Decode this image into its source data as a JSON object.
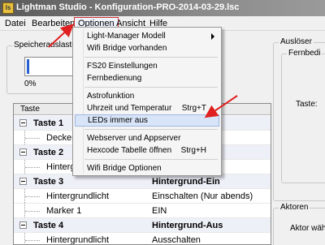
{
  "window": {
    "title": "Lightman Studio - Konfiguration-PRO-2014-03-29.lsc",
    "icon_text": "ls"
  },
  "menubar": [
    {
      "label": "Datei"
    },
    {
      "label": "Bearbeiten"
    },
    {
      "label": "Optionen",
      "active": true
    },
    {
      "label": "Ansicht"
    },
    {
      "label": "Hilfe"
    }
  ],
  "left": {
    "group_label": "Speicherauslastu",
    "progress_text": "0%",
    "progress_value": 0.05
  },
  "right": {
    "ausloeser_label": "Auslöser",
    "fernbedienung_label": "Fernbedi",
    "taste_label": "Taste:",
    "aktoren_label": "Aktoren",
    "aktor_waehlen_label": "Aktor wähl"
  },
  "tree": {
    "column_header": "Taste",
    "rows": [
      {
        "kind": "group",
        "c1": "Taste 1",
        "c2": ""
      },
      {
        "kind": "child",
        "c1": "Deckenl",
        "c2": ""
      },
      {
        "kind": "group",
        "c1": "Taste 2",
        "c2": ""
      },
      {
        "kind": "child",
        "c1": "Hintergr",
        "c2": ""
      },
      {
        "kind": "group",
        "c1": "Taste 3",
        "c2": "Hintergrund-Ein"
      },
      {
        "kind": "child",
        "c1": "Hintergrundlicht",
        "c2": "Einschalten (Nur abends)"
      },
      {
        "kind": "child",
        "c1": "Marker 1",
        "c2": "EIN"
      },
      {
        "kind": "group",
        "c1": "Taste 4",
        "c2": "Hintergrund-Aus"
      },
      {
        "kind": "child",
        "c1": "Hintergrundlicht",
        "c2": "Ausschalten"
      }
    ]
  },
  "optionen_menu": {
    "items": [
      {
        "label": "Light-Manager Modell",
        "submenu": true
      },
      {
        "label": "Wifi Bridge vorhanden"
      },
      {
        "sep": true
      },
      {
        "label": "FS20 Einstellungen"
      },
      {
        "label": "Fernbedienung"
      },
      {
        "sep": true
      },
      {
        "label": "Astrofunktion"
      },
      {
        "label": "Uhrzeit und Temperatur",
        "shortcut": "Strg+T"
      },
      {
        "label": "LEDs immer aus",
        "highlighted": true
      },
      {
        "sep": true
      },
      {
        "label": "Webserver und Appserver"
      },
      {
        "label": "Hexcode Tabelle öffnen",
        "shortcut": "Strg+H"
      },
      {
        "sep": true
      },
      {
        "label": "Wifi Bridge Optionen"
      }
    ]
  },
  "annotation_color": "#e02020"
}
